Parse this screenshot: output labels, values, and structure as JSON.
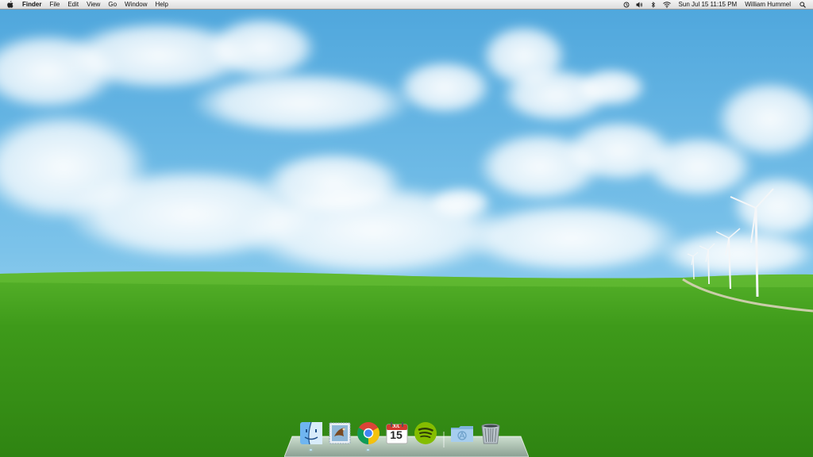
{
  "menubar": {
    "apple_icon": "apple-logo-icon",
    "app_name": "Finder",
    "items": [
      "File",
      "Edit",
      "View",
      "Go",
      "Window",
      "Help"
    ],
    "status_icons": [
      "time-machine-icon",
      "volume-icon",
      "bluetooth-icon",
      "wifi-icon"
    ],
    "datetime": "Sun Jul 15  11:15 PM",
    "user": "William Hummel",
    "search_icon": "spotlight-search-icon"
  },
  "dock": {
    "items": [
      {
        "name": "Finder",
        "icon": "finder-icon",
        "running": true
      },
      {
        "name": "Mail",
        "icon": "mail-icon",
        "running": false
      },
      {
        "name": "Google Chrome",
        "icon": "chrome-icon",
        "running": true
      },
      {
        "name": "Calendar",
        "icon": "calendar-icon",
        "running": false
      },
      {
        "name": "Spotify",
        "icon": "spotify-icon",
        "running": false
      }
    ],
    "calendar": {
      "month": "JUL",
      "day": "15"
    },
    "stack": {
      "name": "Applications",
      "icon": "folder-icon"
    },
    "trash": {
      "name": "Trash",
      "icon": "trash-icon"
    }
  },
  "colors": {
    "sky": "#5aaee0",
    "grass": "#3f9a1c",
    "menubar": "#e8e8e8"
  }
}
